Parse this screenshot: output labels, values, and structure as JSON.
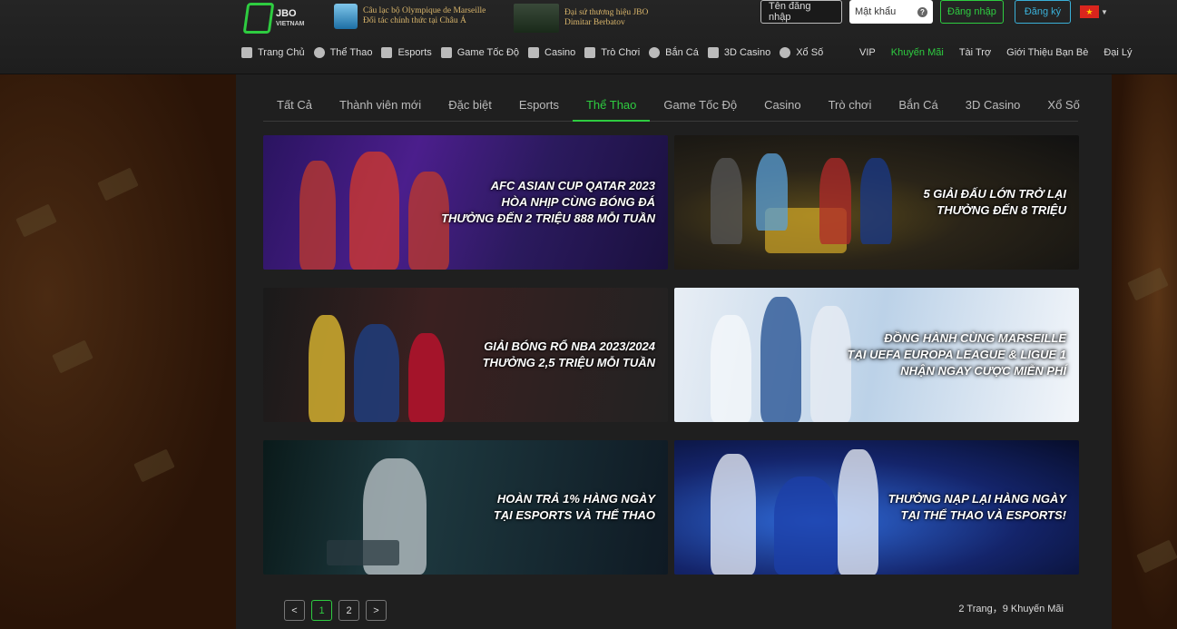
{
  "header": {
    "logo": {
      "name": "JBO",
      "sub": "VIETNAM"
    },
    "partner1": {
      "line1": "Câu lạc bộ Olympique de Marseille",
      "line2": "Đối tác chính thức tại Châu Á"
    },
    "partner2": {
      "line1": "Đại sứ thương hiệu JBO",
      "line2": "Dimitar Berbatov"
    },
    "auth": {
      "username_placeholder": "Tên đăng nhập",
      "password_placeholder": "Mật khẩu",
      "help": "?",
      "login_label": "Đăng nhập",
      "register_label": "Đăng ký"
    },
    "nav": [
      {
        "label": "Trang Chủ",
        "icon": "home-icon"
      },
      {
        "label": "Thể Thao",
        "icon": "soccer-ball-icon"
      },
      {
        "label": "Esports",
        "icon": "gamepad-icon"
      },
      {
        "label": "Game Tốc Độ",
        "icon": "speed-icon"
      },
      {
        "label": "Casino",
        "icon": "cards-icon"
      },
      {
        "label": "Trò Chơi",
        "icon": "slot-icon"
      },
      {
        "label": "Bắn Cá",
        "icon": "fish-icon"
      },
      {
        "label": "3D Casino",
        "icon": "3d-icon"
      },
      {
        "label": "Xổ Số",
        "icon": "lottery-icon"
      }
    ],
    "nav_right": [
      {
        "label": "VIP",
        "active": false
      },
      {
        "label": "Khuyến Mãi",
        "active": true
      },
      {
        "label": "Tài Trợ",
        "active": false
      },
      {
        "label": "Giới Thiệu Bạn Bè",
        "active": false
      },
      {
        "label": "Đại Lý",
        "active": false
      }
    ]
  },
  "tabs": [
    "Tất Cả",
    "Thành viên mới",
    "Đặc biệt",
    "Esports",
    "Thể Thao",
    "Game Tốc Độ",
    "Casino",
    "Trò chơi",
    "Bắn Cá",
    "3D Casino",
    "Xổ Số"
  ],
  "active_tab": "Thể Thao",
  "banners": [
    {
      "caption": "AFC ASIAN CUP QATAR 2023\nHÒA NHỊP CÙNG BÓNG ĐÁ\nTHƯỞNG ĐẾN 2 TRIỆU 888 MỖI TUẦN"
    },
    {
      "caption": "5 GIẢI ĐẤU LỚN TRỞ LẠI\nTHƯỞNG ĐẾN 8 TRIỆU"
    },
    {
      "caption": "GIẢI BÓNG RỔ NBA 2023/2024\nTHƯỞNG 2,5 TRIỆU MỖI TUẦN"
    },
    {
      "caption": "ĐỒNG HÀNH CÙNG MARSEILLE\nTẠI UEFA EUROPA LEAGUE & LIGUE 1\nNHẬN NGAY CƯỢC MIỄN PHÍ"
    },
    {
      "caption": "HOÀN TRẢ 1% HÀNG NGÀY\nTẠI ESPORTS VÀ THỂ THAO"
    },
    {
      "caption": "THƯỞNG NẠP LẠI HÀNG NGÀY\nTẠI THỂ THAO VÀ ESPORTS!"
    }
  ],
  "pagination": {
    "prev": "<",
    "pages": [
      "1",
      "2"
    ],
    "current": "1",
    "next": ">",
    "summary": "2 Trang，9 Khuyến Mãi"
  },
  "colors": {
    "accent": "#2ecc40",
    "register": "#3ab0d8",
    "background": "#3a1e0d",
    "panel": "#1f1f1f"
  }
}
